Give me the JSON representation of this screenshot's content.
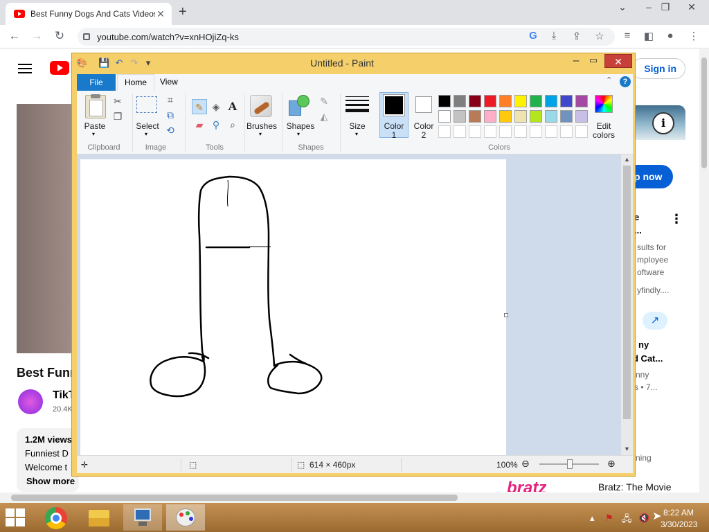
{
  "browser": {
    "tab_title": "Best Funny Dogs And Cats Videos",
    "tab_close": "✕",
    "new_tab": "+",
    "url": "youtube.com/watch?v=xnHOjiZq-ks"
  },
  "youtube": {
    "sign_in": "Sign in",
    "video_title": "Best Funn",
    "channel_name": "TikT",
    "channel_subs": "20.4K",
    "views": "1.2M views",
    "desc_line1": "Funniest D",
    "desc_line2": "Welcome t",
    "show_more": "Show more",
    "shop_now": "p now",
    "ad_title1": "e",
    "ad_title2": "...",
    "ad_text1": "sults for",
    "ad_text2": "mployee",
    "ad_text3": "oftware",
    "ad_domain": "yfindly....",
    "rec_title1": "ny",
    "rec_title2": "d Cat...",
    "rec_channel": "nny",
    "rec_meta": "s  • 7...",
    "rec_side_text": "ning",
    "bratz_thumb_text": "bratz",
    "bratz_title": "Bratz: The Movie"
  },
  "paint": {
    "title": "Untitled - Paint",
    "tabs": {
      "file": "File",
      "home": "Home",
      "view": "View"
    },
    "help": "?",
    "groups": {
      "clipboard": "Clipboard",
      "image": "Image",
      "tools": "Tools",
      "shapes": "Shapes",
      "colors": "Colors"
    },
    "buttons": {
      "paste": "Paste",
      "select": "Select",
      "brushes": "Brushes",
      "shapes": "Shapes",
      "size": "Size",
      "color1_a": "Color",
      "color1_b": "1",
      "color2_a": "Color",
      "color2_b": "2",
      "edit_colors_a": "Edit",
      "edit_colors_b": "colors"
    },
    "palette_row1": [
      "#000000",
      "#7f7f7f",
      "#880015",
      "#ed1c24",
      "#ff7f27",
      "#fff200",
      "#22b14c",
      "#00a2e8",
      "#3f48cc",
      "#a349a4"
    ],
    "palette_row2": [
      "#ffffff",
      "#c3c3c3",
      "#b97a57",
      "#ffaec9",
      "#ffc90e",
      "#efe4b0",
      "#b5e61d",
      "#99d9ea",
      "#7092be",
      "#c8bfe7"
    ],
    "color1": "#000000",
    "color2": "#ffffff",
    "status": {
      "size": "614 × 460px",
      "zoom": "100%"
    }
  },
  "taskbar": {
    "time": "8:22 AM",
    "date": "3/30/2023"
  }
}
